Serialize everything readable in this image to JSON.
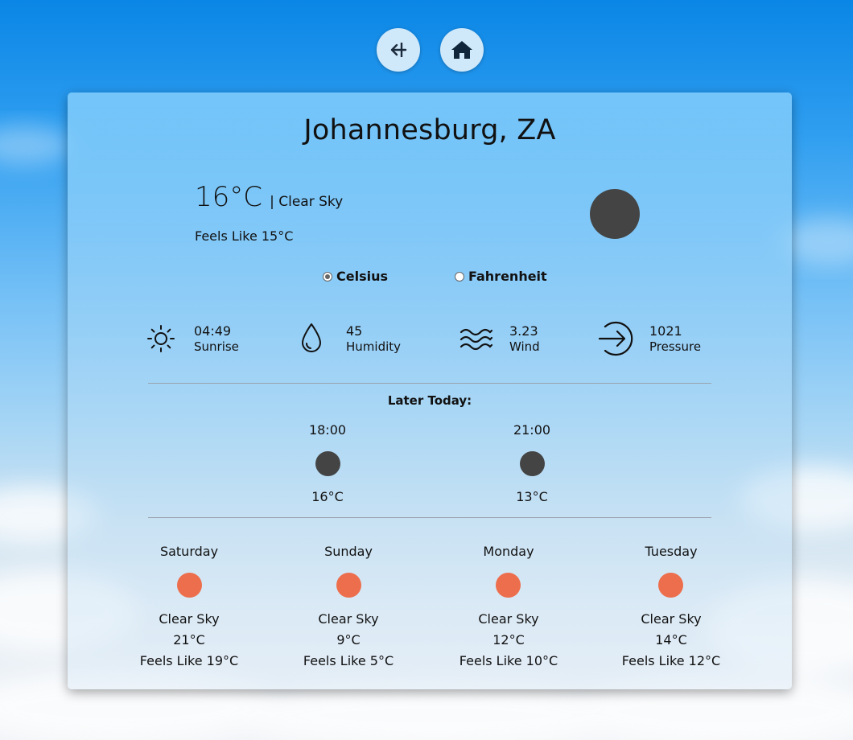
{
  "nav": {
    "back_icon": "arrow-left-icon",
    "home_icon": "home-icon"
  },
  "location": {
    "city": "Johannesburg, ZA"
  },
  "current": {
    "temp": "16°C",
    "description": "| Clear Sky",
    "feels_like": "Feels Like 15°C",
    "icon_color": "#444444"
  },
  "units": {
    "options": [
      {
        "label": "Celsius",
        "selected": true
      },
      {
        "label": "Fahrenheit",
        "selected": false
      }
    ]
  },
  "stats": [
    {
      "icon": "sun-icon",
      "value": "04:49",
      "label": "Sunrise"
    },
    {
      "icon": "droplet-icon",
      "value": "45",
      "label": "Humidity"
    },
    {
      "icon": "wind-waves-icon",
      "value": "3.23",
      "label": "Wind"
    },
    {
      "icon": "arrow-right-circle-icon",
      "value": "1021",
      "label": "Pressure"
    }
  ],
  "later_today": {
    "title": "Later Today:",
    "hours": [
      {
        "time": "18:00",
        "temp": "16°C"
      },
      {
        "time": "21:00",
        "temp": "13°C"
      }
    ]
  },
  "forecast": [
    {
      "day": "Saturday",
      "description": "Clear Sky",
      "temp": "21°C",
      "feels_like": "Feels Like 19°C"
    },
    {
      "day": "Sunday",
      "description": "Clear Sky",
      "temp": "9°C",
      "feels_like": "Feels Like 5°C"
    },
    {
      "day": "Monday",
      "description": "Clear Sky",
      "temp": "12°C",
      "feels_like": "Feels Like 10°C"
    },
    {
      "day": "Tuesday",
      "description": "Clear Sky",
      "temp": "14°C",
      "feels_like": "Feels Like 12°C"
    }
  ],
  "colors": {
    "forecast_dot": "#ec6e4c",
    "hour_dot": "#444444",
    "nav_button": "#cfe8fa"
  }
}
